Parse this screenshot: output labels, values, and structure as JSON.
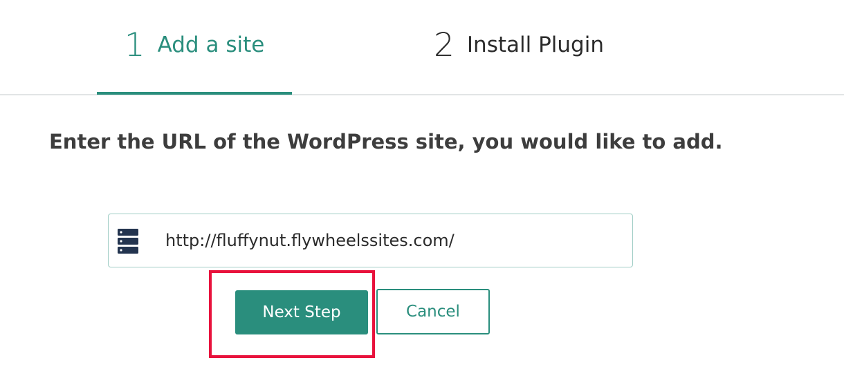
{
  "stepper": {
    "steps": [
      {
        "number": "1",
        "label": "Add a site",
        "active": true
      },
      {
        "number": "2",
        "label": "Install Plugin",
        "active": false
      }
    ]
  },
  "instruction": "Enter the URL of the WordPress site, you would like to add.",
  "url_field": {
    "icon": "server-icon",
    "value": "http://fluffynut.flywheelssites.com/"
  },
  "buttons": {
    "next_label": "Next Step",
    "cancel_label": "Cancel"
  },
  "colors": {
    "accent": "#2a8e7d",
    "highlight": "#e8123c",
    "icon": "#23344f",
    "text": "#3d3d3d"
  }
}
